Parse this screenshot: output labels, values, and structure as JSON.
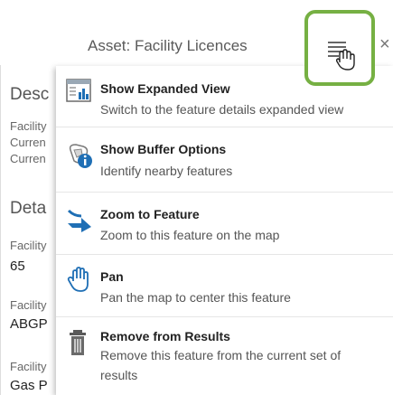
{
  "header": {
    "title": "Asset: Facility Licences",
    "close": "×"
  },
  "left_panel": {
    "section1_heading": "Desc",
    "section1_lines": [
      "Facility",
      "Curren",
      "Curren"
    ],
    "section2_heading": "Deta",
    "fields": [
      {
        "label": "Facility",
        "value": "65"
      },
      {
        "label": "Facility",
        "value": "ABGP"
      },
      {
        "label": "Facility",
        "value": "Gas P"
      }
    ]
  },
  "menu": {
    "items": [
      {
        "icon": "expanded-view-icon",
        "title": "Show Expanded View",
        "desc": "Switch to the feature details expanded view"
      },
      {
        "icon": "buffer-info-icon",
        "title": "Show Buffer Options",
        "desc": "Identify nearby features"
      },
      {
        "icon": "zoom-arrow-icon",
        "title": "Zoom to Feature",
        "desc": "Zoom to this feature on the map"
      },
      {
        "icon": "hand-pan-icon",
        "title": "Pan",
        "desc": "Pan the map to center this feature"
      },
      {
        "icon": "trash-icon",
        "title": "Remove from Results",
        "desc1": "Remove this feature from the current set of",
        "desc2": "results"
      }
    ]
  },
  "colors": {
    "highlight": "#76b043",
    "icon_blue": "#1f6fb5"
  }
}
